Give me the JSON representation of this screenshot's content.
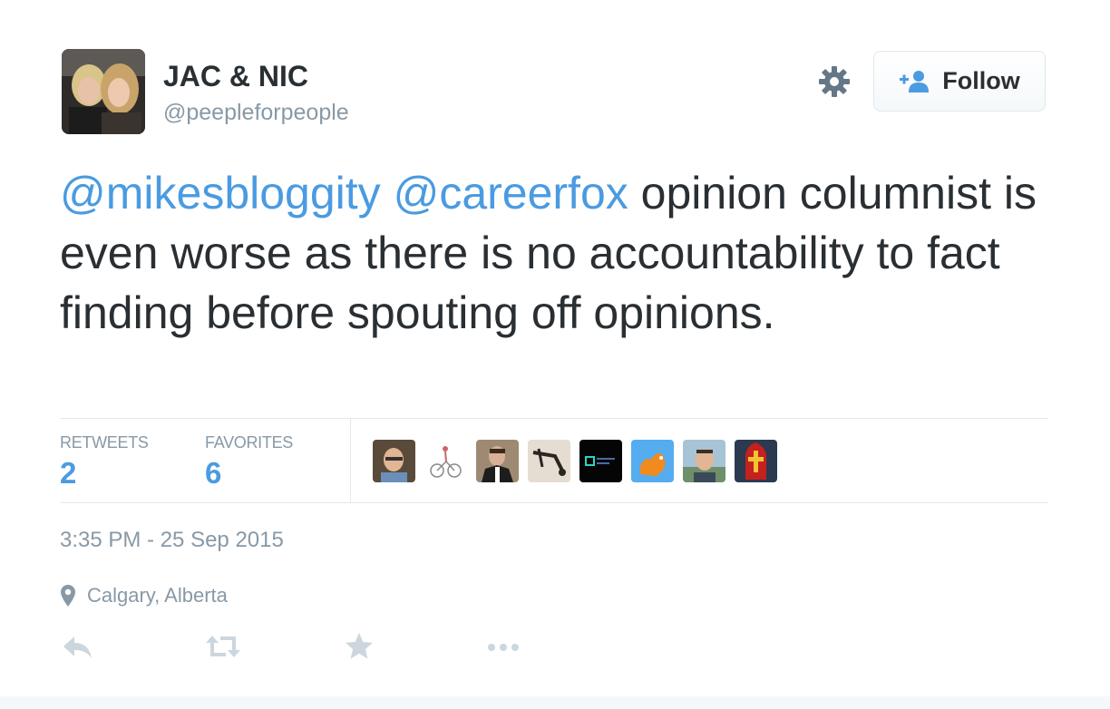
{
  "author": {
    "display_name": "JAC & NIC",
    "screen_name": "@peepleforpeople",
    "avatar_icon": "profile-photo"
  },
  "header": {
    "settings_icon": "gear-icon",
    "follow_label": "Follow",
    "follow_icon": "add-user-icon"
  },
  "tweet": {
    "mention_1": "@mikesbloggity",
    "mention_2": "@careerfox",
    "body": " opinion columnist is even worse as there is no accountability to fact finding before spouting off opinions."
  },
  "stats": {
    "retweets_label": "RETWEETS",
    "retweets_count": "2",
    "favorites_label": "FAVORITES",
    "favorites_count": "6"
  },
  "favoriters": [
    "avatar-man-with-glasses",
    "avatar-cyclist-sketch",
    "avatar-man-in-suit",
    "avatar-tools-photo",
    "avatar-dark-logo",
    "avatar-orange-squirrel",
    "avatar-smiling-man",
    "avatar-red-mitre"
  ],
  "meta": {
    "timestamp": "3:35 PM - 25 Sep 2015",
    "location": "Calgary, Alberta",
    "location_icon": "map-pin-icon"
  },
  "actions": [
    "reply-icon",
    "retweet-icon",
    "favorite-star-icon",
    "more-dots-icon"
  ],
  "colors": {
    "link": "#4a9be1",
    "text": "#292f33",
    "muted": "#8899a6",
    "border": "#e1e8ed",
    "action_icons": "#ccd6dd"
  }
}
